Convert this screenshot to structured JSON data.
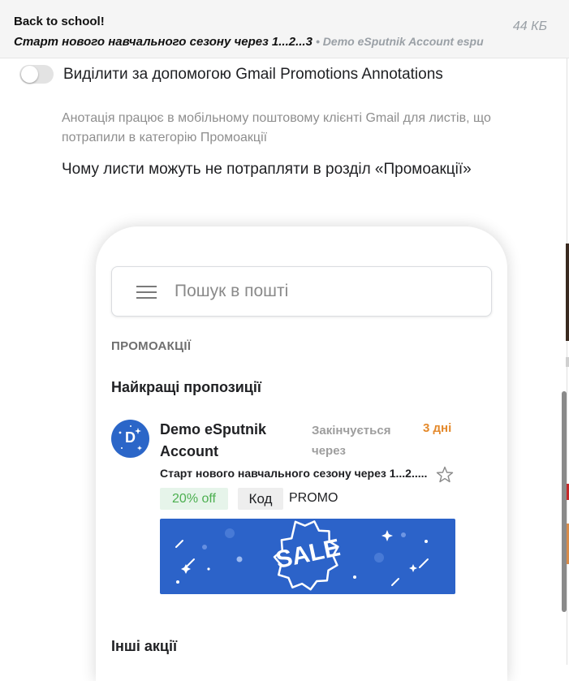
{
  "header": {
    "title": "Back to school!",
    "subject": "Старт нового навчального сезону через 1...2...3",
    "sender": "• Demo eSputnik Account espu",
    "size": "44 КБ"
  },
  "annotations": {
    "toggle_label": "Виділити за допомогою Gmail Promotions Annotations",
    "toggle_on": false,
    "note": "Анотація працює в мобільному поштовому клієнті Gmail для листів, що потрапили в категорію Промоакції",
    "why_link": "Чому листи можуть не потрапляти в розділ «Промоакції»"
  },
  "preview": {
    "search_placeholder": "Пошук в пошті",
    "section_label": "ПРОМОАКЦІЇ",
    "best_offers": "Найкращі пропозиції",
    "avatar_letter": "D",
    "sender_name": "Demo eSputnik Account",
    "expires_label": "Закінчується через",
    "expires_days": "3 дні",
    "subject": "Старт нового навчального сезону через 1...2.....",
    "discount": "20% off",
    "code_label": "Код",
    "code_value": "PROMO",
    "banner_text": "SALE",
    "other_offers": "Інші акції"
  },
  "colors": {
    "accent_blue": "#2c63c9",
    "expires_orange": "#e4892b",
    "discount_green": "#4caf50"
  }
}
